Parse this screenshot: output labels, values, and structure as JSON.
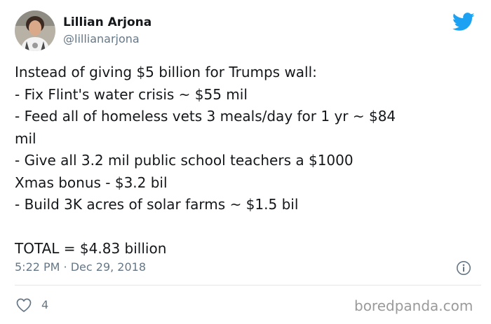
{
  "author": {
    "name": "Lillian Arjona",
    "handle": "@lillianarjona",
    "avatar_icon": "user-avatar-photo"
  },
  "brand": {
    "icon": "twitter-bird-icon",
    "color": "#1da1f2"
  },
  "tweet": {
    "lines": [
      "Instead of giving $5 billion for Trumps wall:",
      "- Fix Flint's water crisis ~ $55 mil",
      "- Feed all of homeless vets 3 meals/day for 1 yr ~ $84",
      "mil",
      "- Give all 3.2 mil public school teachers a $1000",
      "Xmas bonus - $3.2 bil",
      "- Build 3K acres of solar farms ~ $1.5 bil",
      "",
      "TOTAL = $4.83 billion"
    ]
  },
  "meta": {
    "timestamp": "5:22 PM · Dec 29, 2018",
    "info_icon": "info-icon"
  },
  "actions": {
    "like_icon": "heart-icon",
    "like_count": "4"
  },
  "watermark": "boredpanda.com"
}
